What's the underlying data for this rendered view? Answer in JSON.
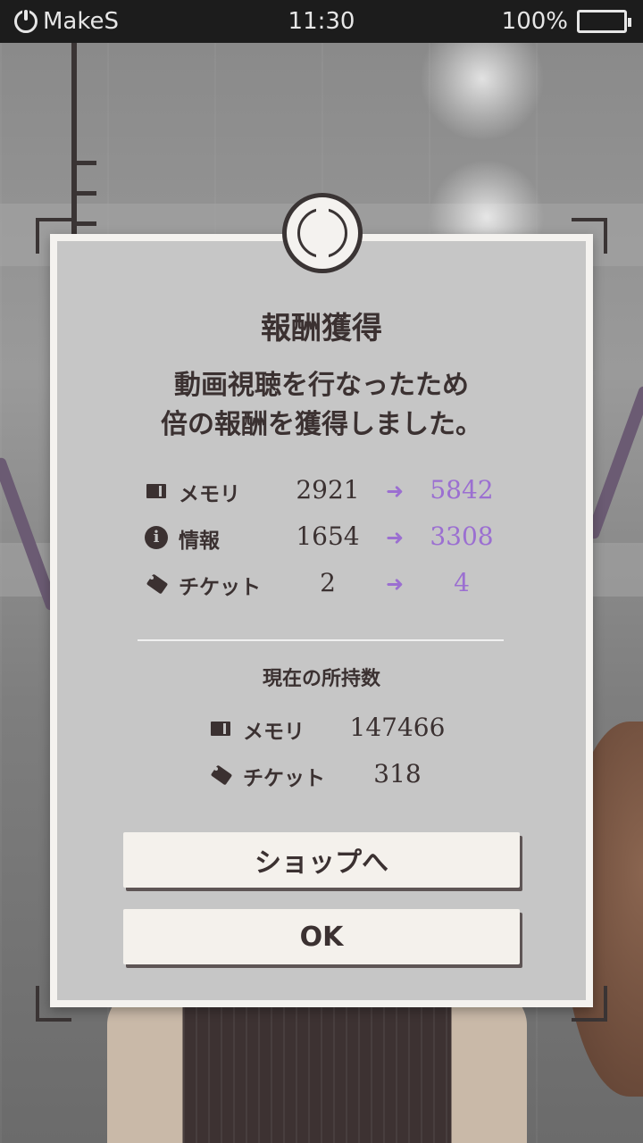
{
  "status_bar": {
    "app_name": "MakeS",
    "time": "11:30",
    "battery": "100%"
  },
  "dialog": {
    "title": "報酬獲得",
    "message_line1": "動画視聴を行なったため",
    "message_line2": "倍の報酬を獲得しました。",
    "rewards": [
      {
        "icon": "memory-icon",
        "label": "メモリ",
        "before": "2921",
        "after": "5842"
      },
      {
        "icon": "info-icon",
        "label": "情報",
        "before": "1654",
        "after": "3308"
      },
      {
        "icon": "ticket-icon",
        "label": "チケット",
        "before": "2",
        "after": "4"
      }
    ],
    "arrow": "➜",
    "holdings_title": "現在の所持数",
    "holdings": [
      {
        "icon": "memory-icon",
        "label": "メモリ",
        "value": "147466"
      },
      {
        "icon": "ticket-icon",
        "label": "チケット",
        "value": "318"
      }
    ],
    "shop_button": "ショップへ",
    "ok_button": "OK"
  },
  "colors": {
    "accent": "#9b6fd1",
    "text": "#3b3131",
    "panel": "#c6c6c6",
    "frame": "#f4f2ef"
  }
}
